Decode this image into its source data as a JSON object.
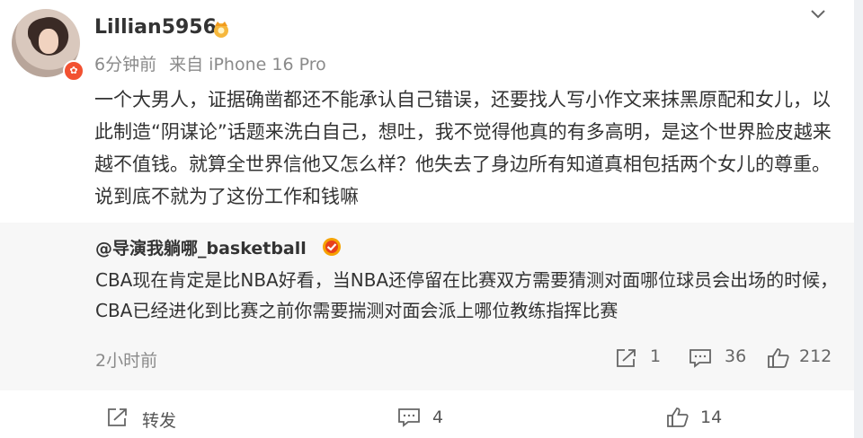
{
  "post": {
    "username": "Lillian5956",
    "time": "6分钟前",
    "source": "来自 iPhone 16 Pro",
    "content": "一个大男人，证据确凿都还不能承认自己错误，还要找人写小作文来抹黑原配和女儿，以此制造“阴谋论”话题来洗白自己，想吐，我不觉得他真的有多高明，是这个世界脸皮越来越不值钱。就算全世界信他又怎么样？他失去了身边所有知道真相包括两个女儿的尊重。说到底不就为了这份工作和钱嘛",
    "avatar_badge": "✿"
  },
  "quote": {
    "username": "@导演我躺哪_basketball",
    "content": "CBA现在肯定是比NBA好看，当NBA还停留在比赛双方需要猜测对面哪位球员会出场的时候，CBA已经进化到比赛之前你需要揣测对面会派上哪位教练指挥比赛",
    "time": "2小时前",
    "reposts": "1",
    "comments": "36",
    "likes": "212"
  },
  "actions": {
    "repost_label": "转发",
    "comments": "4",
    "likes": "14"
  },
  "colors": {
    "quote_bg": "#f7f7f7",
    "badge": "#f25131",
    "verified": "#f6a200"
  }
}
